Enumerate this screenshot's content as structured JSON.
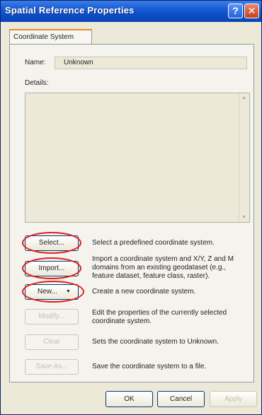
{
  "window": {
    "title": "Spatial Reference Properties",
    "help_label": "?",
    "close_label": "✕"
  },
  "tabs": [
    {
      "label": "Coordinate System",
      "selected": true
    }
  ],
  "fields": {
    "name_label": "Name:",
    "name_value": "Unknown",
    "details_label": "Details:"
  },
  "actions": [
    {
      "label": "Select...",
      "description": "Select a predefined coordinate system.",
      "enabled": true,
      "circled": true
    },
    {
      "label": "Import...",
      "description": "Import a coordinate system and X/Y, Z and M domains from an existing geodataset (e.g., feature dataset, feature class, raster).",
      "enabled": true,
      "circled": true
    },
    {
      "label": "New...",
      "description": "Create a new coordinate system.",
      "enabled": true,
      "circled": true,
      "has_dropdown": true
    },
    {
      "label": "Modify...",
      "description": "Edit the properties of the currently selected coordinate system.",
      "enabled": false
    },
    {
      "label": "Clear",
      "description": "Sets the coordinate system to Unknown.",
      "enabled": false
    },
    {
      "label": "Save As...",
      "description": "Save the coordinate system to a file.",
      "enabled": false
    }
  ],
  "footer": {
    "ok_label": "OK",
    "cancel_label": "Cancel",
    "apply_label": "Apply"
  },
  "colors": {
    "titlebar": "#0a4cc6",
    "annotation": "#e01e1e",
    "window_bg": "#ece9d8"
  },
  "icons": {
    "dropdown": "triangle-down-icon",
    "scroll_up": "scroll-up-icon",
    "scroll_down": "scroll-down-icon"
  }
}
